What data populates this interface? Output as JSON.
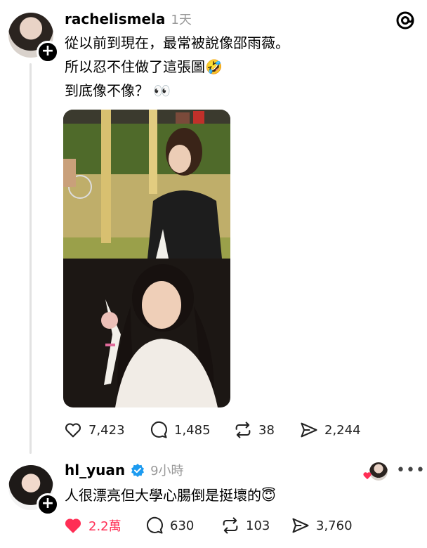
{
  "post": {
    "username": "rachelismela",
    "time": "1天",
    "lines": [
      "從以前到現在，最常被說像邵雨薇。",
      "所以忍不住做了這張圖🤣",
      "到底像不像？ 👀"
    ],
    "actions": {
      "likes": "7,423",
      "comments": "1,485",
      "reposts": "38",
      "shares": "2,244"
    }
  },
  "reply": {
    "username": "hl_yuan",
    "verified": true,
    "time": "9小時",
    "text": "人很漂亮但大學心腸倒是挺壞的😇",
    "actions": {
      "likes": "2.2萬",
      "comments": "630",
      "reposts": "103",
      "shares": "3,760"
    }
  },
  "colors": {
    "like_active": "#ff2e55",
    "verified": "#1d9bf0",
    "meta": "#999999"
  },
  "icons": [
    "threads-logo-icon",
    "plus-icon",
    "heart-icon",
    "comment-icon",
    "repost-icon",
    "share-icon",
    "verified-icon",
    "more-icon"
  ]
}
